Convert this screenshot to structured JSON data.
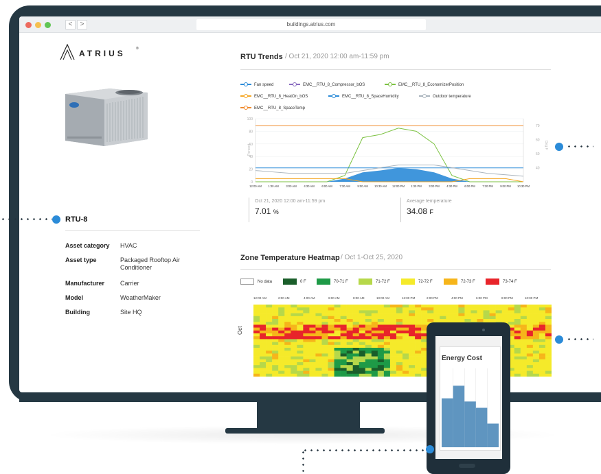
{
  "browser": {
    "url": "buildings.atrius.com",
    "back_label": "<",
    "forward_label": ">"
  },
  "brand": {
    "name": "ATRIUS",
    "mark": "®"
  },
  "asset": {
    "name": "RTU-8",
    "properties": [
      {
        "label": "Asset category",
        "value": "HVAC"
      },
      {
        "label": "Asset type",
        "value": "Packaged Rooftop Air Conditioner"
      },
      {
        "label": "Manufacturer",
        "value": "Carrier"
      },
      {
        "label": "Model",
        "value": "WeatherMaker"
      },
      {
        "label": "Building",
        "value": "Site HQ"
      }
    ]
  },
  "trends": {
    "title": "RTU Trends",
    "subtitle": "/   Oct 21, 2020 12:00 am-11:59 pm",
    "legend": [
      {
        "name": "Fan speed",
        "color": "#2b8bd8"
      },
      {
        "name": "EMC__RTU_8_Compressor_bOS",
        "color": "#8a6cc0"
      },
      {
        "name": "EMC__RTU_8_EconomizerPosition",
        "color": "#7cc242"
      },
      {
        "name": "EMC__RTU_8_HeatOn_bOS",
        "color": "#f5a623"
      },
      {
        "name": "EMC__RTU_8_SpaceHumidity",
        "color": "#2b8bd8"
      },
      {
        "name": "Outdoor temperature",
        "color": "#aab4bd"
      },
      {
        "name": "EMC__RTU_8_SpaceTemp",
        "color": "#f08a2c"
      }
    ],
    "y_left_label": "Percent",
    "y_right_label": "Deg F",
    "stats": [
      {
        "label": "Oct 21, 2020 12:00 am-11:59 pm",
        "value": "7.01",
        "unit": "%"
      },
      {
        "label": "Average temperature",
        "value": "34.08",
        "unit": "F"
      }
    ]
  },
  "heatmap": {
    "title": "Zone Temperature Heatmap",
    "subtitle": "/   Oct 1-Oct 25, 2020",
    "row_label": "Oct",
    "legend": [
      {
        "label": "No data",
        "color": "#ffffff"
      },
      {
        "label": "0 F",
        "color": "#1a5e2a"
      },
      {
        "label": "70-71 F",
        "color": "#1e9a47"
      },
      {
        "label": "71-72 F",
        "color": "#b6d84a"
      },
      {
        "label": "72-72 F",
        "color": "#f5ea2a"
      },
      {
        "label": "72-73 F",
        "color": "#f6b51a"
      },
      {
        "label": "73-74 F",
        "color": "#e8242a"
      }
    ],
    "time_labels": [
      "12:00 AM",
      "2:00 AM",
      "4:00 AM",
      "6:00 AM",
      "8:00 AM",
      "10:00 AM",
      "12:00 PM",
      "2:00 PM",
      "4:00 PM",
      "6:00 PM",
      "8:00 PM",
      "10:00 PM"
    ]
  },
  "mobile": {
    "card_title": "Energy Cost",
    "bars": [
      0.62,
      0.78,
      0.58,
      0.5,
      0.3
    ]
  },
  "chart_data": {
    "type": "line",
    "title": "RTU Trends",
    "x": [
      "12:00 AM",
      "1:30 AM",
      "3:00 AM",
      "4:30 AM",
      "6:00 AM",
      "7:30 AM",
      "9:00 AM",
      "10:30 AM",
      "12:00 PM",
      "1:30 PM",
      "3:00 PM",
      "4:30 PM",
      "6:00 PM",
      "7:30 PM",
      "9:00 PM",
      "10:30 PM"
    ],
    "ylim_left": [
      0,
      100
    ],
    "yticks_left": [
      0,
      20,
      40,
      60,
      80,
      100
    ],
    "ylim_right": [
      30,
      75
    ],
    "yticks_right": [
      40,
      50,
      60,
      70
    ],
    "series": [
      {
        "name": "EMC__RTU_8_SpaceTemp",
        "axis": "right",
        "values": [
          70,
          70,
          70,
          70,
          70,
          70,
          70,
          70,
          70,
          70,
          70,
          70,
          70,
          70,
          70,
          70
        ]
      },
      {
        "name": "EMC__RTU_8_EconomizerPosition",
        "axis": "left",
        "values": [
          0,
          0,
          0,
          0,
          0,
          10,
          70,
          75,
          85,
          80,
          60,
          10,
          0,
          0,
          0,
          0
        ]
      },
      {
        "name": "Fan speed",
        "axis": "left",
        "values": [
          22,
          22,
          22,
          22,
          22,
          22,
          22,
          22,
          22,
          22,
          22,
          22,
          22,
          22,
          22,
          22
        ]
      },
      {
        "name": "EMC__RTU_8_SpaceHumidity",
        "axis": "left",
        "values": [
          0,
          0,
          0,
          0,
          0,
          5,
          15,
          18,
          22,
          20,
          15,
          5,
          0,
          0,
          0,
          0
        ]
      },
      {
        "name": "Outdoor temperature",
        "axis": "right",
        "values": [
          38,
          37,
          36,
          36,
          36,
          36,
          38,
          40,
          42,
          42,
          42,
          40,
          38,
          36,
          35,
          34
        ]
      },
      {
        "name": "EMC__RTU_8_HeatOn_bOS",
        "axis": "left",
        "values": [
          5,
          5,
          5,
          5,
          5,
          5,
          0,
          0,
          0,
          0,
          0,
          0,
          5,
          5,
          5,
          0
        ]
      }
    ]
  }
}
